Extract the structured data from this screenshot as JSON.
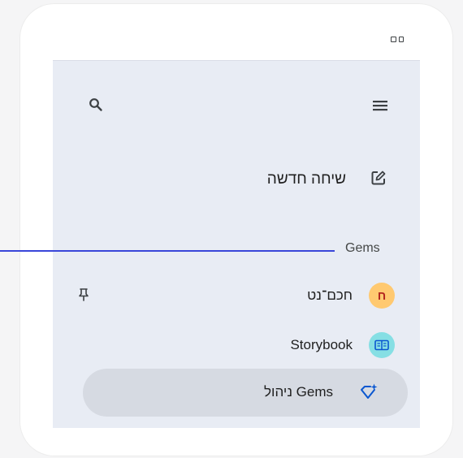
{
  "header": {
    "view_toggle_icon": "grid-view-icon"
  },
  "sidebar": {
    "search_icon": "search-icon",
    "menu_icon": "menu-icon",
    "new_chat": {
      "label": "שיחה חדשה",
      "icon": "edit-icon"
    },
    "gems_section": {
      "title": "Gems",
      "items": [
        {
          "label": "חכם־נט",
          "avatar_letter": "ח",
          "avatar_color": "#ffc970",
          "pinned": true
        },
        {
          "label": "Storybook",
          "avatar_icon": "book-icon",
          "avatar_color": "#86dfe4",
          "pinned": false
        }
      ],
      "manage": {
        "label": "ניהול Gems",
        "icon": "gem-spark-icon"
      }
    }
  },
  "colors": {
    "panel_bg": "#e8ecf4",
    "active_row_bg": "#d6dae2",
    "callout_line": "#3946d9"
  }
}
